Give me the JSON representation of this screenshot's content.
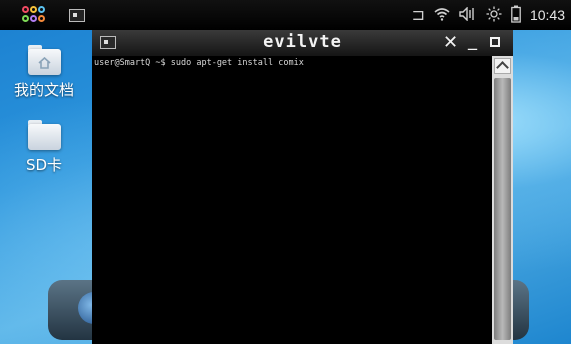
{
  "statusbar": {
    "launcher_colors": [
      "#f04a63",
      "#f5c13a",
      "#5bc2f0",
      "#7ed957",
      "#b07df0",
      "#f58a3a"
    ],
    "icons": [
      "launcher-icon",
      "screen-icon",
      "battery-dock-icon",
      "wifi-icon",
      "volume-icon",
      "brightness-icon",
      "battery-icon"
    ],
    "time": "10:43"
  },
  "desktop": {
    "items": [
      {
        "label": "我的文档",
        "icon": "home-folder-icon"
      },
      {
        "label": "SD卡",
        "icon": "folder-icon"
      }
    ]
  },
  "window": {
    "title": "evilvte",
    "controls": {
      "close": "✕",
      "minimize": "_",
      "maximize": "□"
    }
  },
  "terminal": {
    "prompt": "user@SmartQ ~$ sudo apt-get install comix"
  }
}
